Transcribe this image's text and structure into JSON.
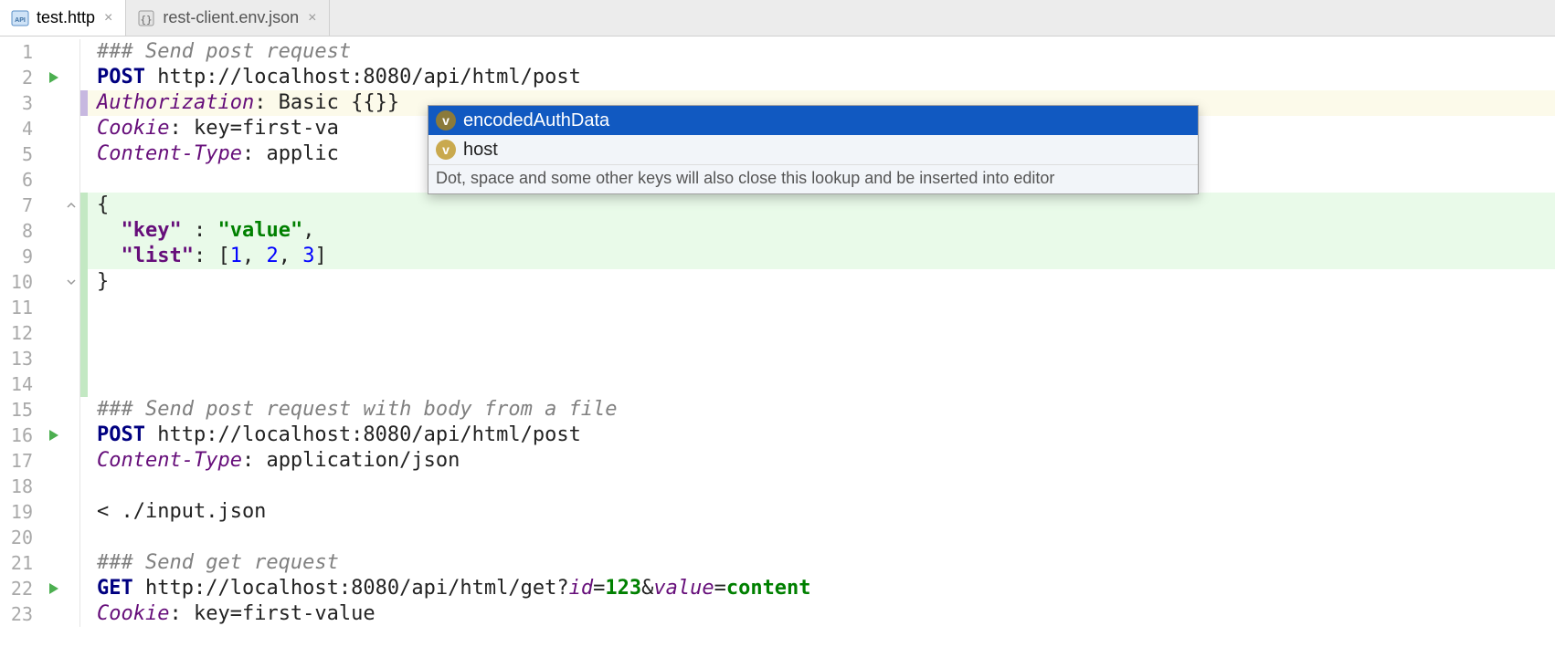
{
  "tabs": [
    {
      "label": "test.http",
      "active": true
    },
    {
      "label": "rest-client.env.json",
      "active": false
    }
  ],
  "lines": {
    "l1": {
      "comment": "### Send post request"
    },
    "l2": {
      "method": "POST",
      "url": "http://localhost:8080/api/html/post"
    },
    "l3": {
      "header": "Authorization",
      "rest": ": Basic {{}}"
    },
    "l4": {
      "header": "Cookie",
      "rest": ": key=first-va"
    },
    "l5": {
      "header": "Content-Type",
      "rest": ": applic"
    },
    "l7": {
      "brace": "{"
    },
    "l8": {
      "key": "\"key\"",
      "sep": " : ",
      "val": "\"value\"",
      "tail": ","
    },
    "l9": {
      "key": "\"list\"",
      "sep": ": ",
      "pre": "[",
      "n1": "1",
      "c1": ", ",
      "n2": "2",
      "c2": ", ",
      "n3": "3",
      "post": "]"
    },
    "l10": {
      "brace": "}"
    },
    "l15": {
      "comment": "### Send post request with body from a file"
    },
    "l16": {
      "method": "POST",
      "url": "http://localhost:8080/api/html/post"
    },
    "l17": {
      "header": "Content-Type",
      "rest": ": application/json"
    },
    "l19": {
      "text": "< ./input.json"
    },
    "l21": {
      "comment": "### Send get request"
    },
    "l22": {
      "method": "GET",
      "urlA": "http://localhost:8080/api/html/get?",
      "p1": "id",
      "eq1": "=",
      "v1": "123",
      "amp": "&",
      "p2": "value",
      "eq2": "=",
      "v2": "content"
    },
    "l23": {
      "header": "Cookie",
      "rest": ": key=first-value"
    }
  },
  "gutter_numbers": [
    "1",
    "2",
    "3",
    "4",
    "5",
    "6",
    "7",
    "8",
    "9",
    "10",
    "11",
    "12",
    "13",
    "14",
    "15",
    "16",
    "17",
    "18",
    "19",
    "20",
    "21",
    "22",
    "23"
  ],
  "completion": {
    "items": [
      {
        "label": "encodedAuthData",
        "selected": true
      },
      {
        "label": "host",
        "selected": false
      }
    ],
    "hint": "Dot, space and some other keys will also close this lookup and be inserted into editor"
  },
  "icons": {
    "api_label": "API",
    "v_label": "v"
  }
}
